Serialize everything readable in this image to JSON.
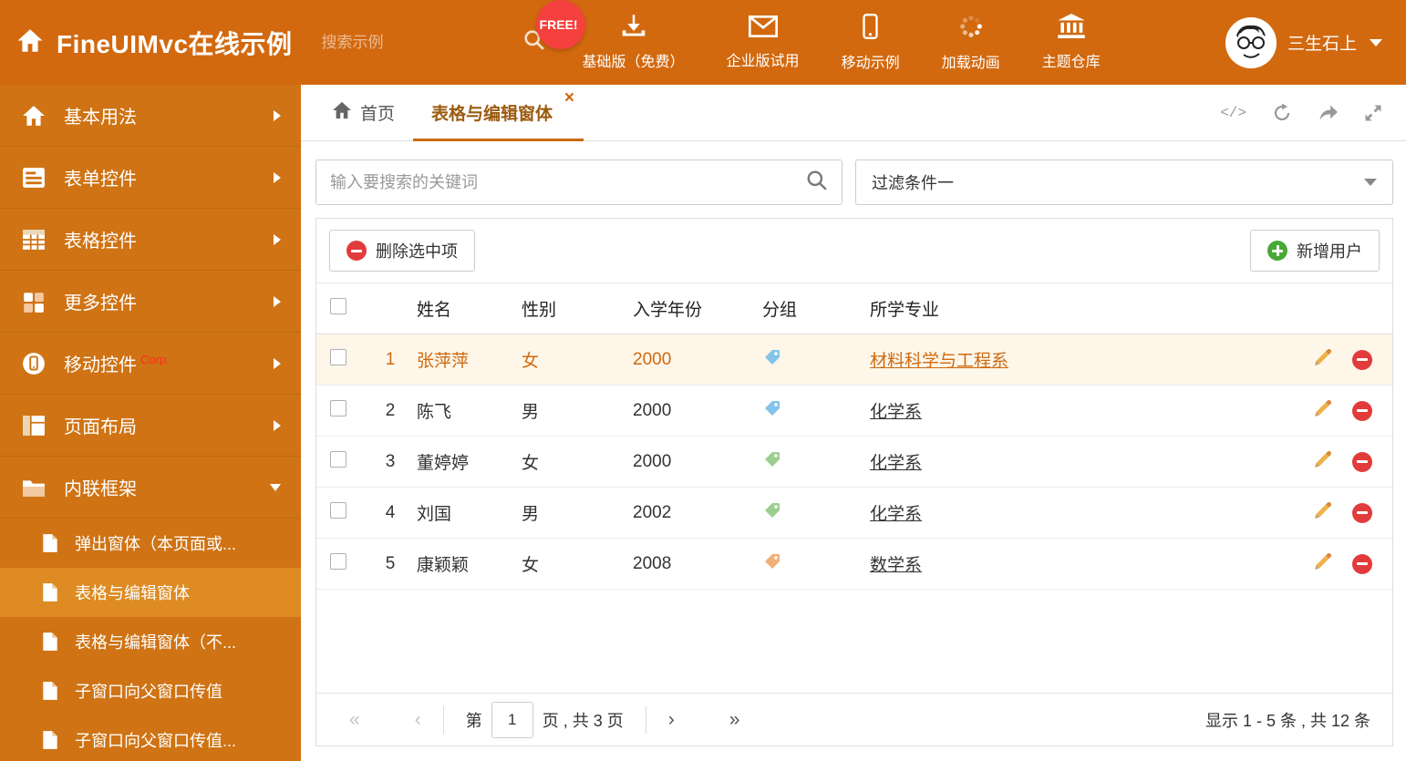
{
  "colors": {
    "header_bg": "#d2690f",
    "sidebar_bg": "#cf7314",
    "sidebar_active_bg": "#dd8b22",
    "accent_orange": "#cf6a10",
    "free_badge_bg": "#f5413d",
    "delete_red": "#e23b3b",
    "add_green": "#47a836",
    "selected_row_bg": "#fdf6e9"
  },
  "header": {
    "title": "FineUIMvc在线示例",
    "search_placeholder": "搜索示例",
    "free_badge": "FREE!",
    "nav": [
      {
        "icon": "download-icon",
        "label": "基础版（免费）"
      },
      {
        "icon": "mail-icon",
        "label": "企业版试用"
      },
      {
        "icon": "mobile-icon",
        "label": "移动示例"
      },
      {
        "icon": "spinner-icon",
        "label": "加载动画"
      },
      {
        "icon": "bank-icon",
        "label": "主题仓库"
      }
    ],
    "user_name": "三生石上"
  },
  "sidebar": {
    "items": [
      {
        "icon": "home-icon",
        "label": "基本用法"
      },
      {
        "icon": "form-icon",
        "label": "表单控件"
      },
      {
        "icon": "grid-icon",
        "label": "表格控件"
      },
      {
        "icon": "controls-icon",
        "label": "更多控件"
      },
      {
        "icon": "mobile-icon",
        "label": "移动控件",
        "badge": "Corp."
      },
      {
        "icon": "layout-icon",
        "label": "页面布局"
      },
      {
        "icon": "frame-icon",
        "label": "内联框架"
      }
    ],
    "subitems": [
      {
        "icon": "file-icon",
        "label": "弹出窗体（本页面或..."
      },
      {
        "icon": "file-icon",
        "label": "表格与编辑窗体"
      },
      {
        "icon": "file-icon",
        "label": "表格与编辑窗体（不..."
      },
      {
        "icon": "file-icon",
        "label": "子窗口向父窗口传值"
      },
      {
        "icon": "file-icon",
        "label": "子窗口向父窗口传值..."
      }
    ]
  },
  "tabs": {
    "home": "首页",
    "active": "表格与编辑窗体",
    "close": "×",
    "code_icon_text": "</>"
  },
  "filter": {
    "search_placeholder": "输入要搜索的关键词",
    "dropdown_value": "过滤条件一"
  },
  "toolbar": {
    "delete_label": "删除选中项",
    "add_label": "新增用户"
  },
  "table": {
    "columns": {
      "name": "姓名",
      "gender": "性别",
      "year": "入学年份",
      "group": "分组",
      "major": "所学专业"
    },
    "rows": [
      {
        "num": "1",
        "name": "张萍萍",
        "gender": "女",
        "year": "2000",
        "tag_color": "#85c4ea",
        "major": "材料科学与工程系"
      },
      {
        "num": "2",
        "name": "陈飞",
        "gender": "男",
        "year": "2000",
        "tag_color": "#85c4ea",
        "major": "化学系"
      },
      {
        "num": "3",
        "name": "董婷婷",
        "gender": "女",
        "year": "2000",
        "tag_color": "#9ccf8f",
        "major": "化学系"
      },
      {
        "num": "4",
        "name": "刘国",
        "gender": "男",
        "year": "2002",
        "tag_color": "#9ccf8f",
        "major": "化学系"
      },
      {
        "num": "5",
        "name": "康颖颖",
        "gender": "女",
        "year": "2008",
        "tag_color": "#f2b079",
        "major": "数学系"
      }
    ]
  },
  "pagination": {
    "first": "«",
    "prev": "‹",
    "page_label": "第",
    "page_value": "1",
    "total_label": "页 , 共 3 页",
    "next": "›",
    "last": "»",
    "summary": "显示 1 - 5 条 , 共 12 条"
  }
}
